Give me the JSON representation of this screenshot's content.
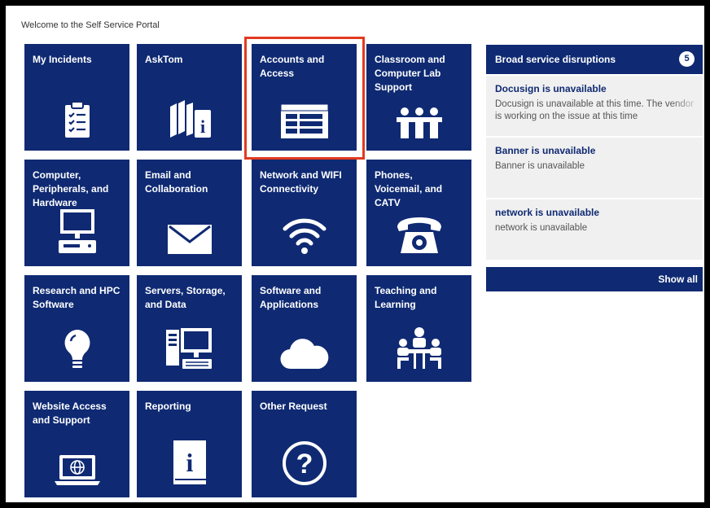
{
  "welcome": "Welcome to the Self Service Portal",
  "tiles": [
    {
      "label": "My Incidents",
      "icon": "clipboard-checklist-icon"
    },
    {
      "label": "AskTom",
      "icon": "books-info-icon"
    },
    {
      "label": "Accounts and\nAccess",
      "icon": "window-form-icon"
    },
    {
      "label": "Classroom and\nComputer Lab\nSupport",
      "icon": "classroom-seats-icon"
    },
    {
      "label": "Computer,\nPeripherals, and\nHardware",
      "icon": "desktop-computer-icon"
    },
    {
      "label": "Email and\nCollaboration",
      "icon": "envelope-icon"
    },
    {
      "label": "Network and WIFI\nConnectivity",
      "icon": "wifi-icon"
    },
    {
      "label": "Phones,\nVoicemail, and\nCATV",
      "icon": "telephone-icon"
    },
    {
      "label": "Research and HPC\nSoftware",
      "icon": "lightbulb-icon"
    },
    {
      "label": "Servers, Storage,\nand Data",
      "icon": "server-monitor-icon"
    },
    {
      "label": "Software and\nApplications",
      "icon": "cloud-icon"
    },
    {
      "label": "Teaching and\nLearning",
      "icon": "meeting-table-icon"
    },
    {
      "label": "Website Access\nand Support",
      "icon": "laptop-globe-icon"
    },
    {
      "label": "Reporting",
      "icon": "info-book-icon"
    },
    {
      "label": "Other Request",
      "icon": "question-circle-icon"
    }
  ],
  "panel": {
    "title": "Broad service disruptions",
    "count": "5",
    "items": [
      {
        "title": "Docusign is unavailable",
        "desc": "Docusign is unavailable at this time. The vendor is working on the issue at this time"
      },
      {
        "title": "Banner is unavailable",
        "desc": "Banner is unavailable"
      },
      {
        "title": "network is unavailable",
        "desc": "network is unavailable"
      }
    ],
    "show_all": "Show all"
  },
  "colors": {
    "tile": "#0f2a73",
    "highlight": "#e23a1f",
    "item_bg": "#f0f0f0"
  }
}
